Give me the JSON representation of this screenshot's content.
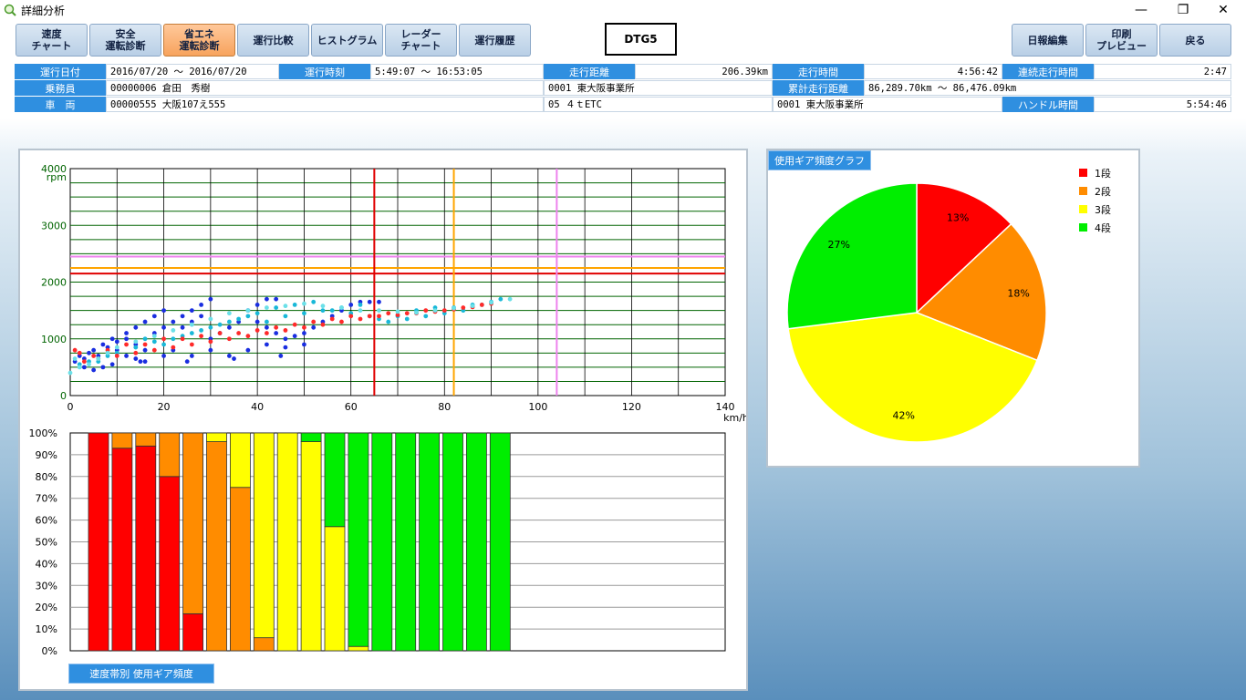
{
  "window": {
    "title": "詳細分析",
    "minimize_glyph": "—",
    "maximize_glyph": "❐",
    "close_glyph": "✕",
    "app_icon": "magnifier-chart-icon"
  },
  "toolbar": {
    "buttons": [
      {
        "label": "速度\nチャート"
      },
      {
        "label": "安全\n運転診断"
      },
      {
        "label": "省エネ\n運転診断",
        "active": true
      },
      {
        "label": "運行比較"
      },
      {
        "label": "ヒストグラム"
      },
      {
        "label": "レーダー\nチャート"
      },
      {
        "label": "運行履歴"
      }
    ],
    "model": "DTG5",
    "right_buttons": [
      {
        "label": "日報編集"
      },
      {
        "label": "印刷\nプレビュー"
      },
      {
        "label": "戻る"
      }
    ]
  },
  "info": {
    "r1": {
      "date_label": "運行日付",
      "date_value": "2016/07/20 〜 2016/07/20",
      "time_label": "運行時刻",
      "time_value": "5:49:07 〜 16:53:05",
      "distance_label": "走行距離",
      "distance_value": "206.39km",
      "drive_time_label": "走行時間",
      "drive_time_value": "4:56:42",
      "continuous_label": "連続走行時間",
      "continuous_value": "2:47"
    },
    "r2": {
      "driver_label": "乗務員",
      "driver_value": "00000006 倉田　秀樹",
      "office_value": "0001 東大阪事業所",
      "cumulative_label": "累計走行距離",
      "cumulative_value": "86,289.70km 〜 86,476.09km"
    },
    "r3": {
      "vehicle_label": "車　両",
      "vehicle_value": "00000555 大阪107え555",
      "vehicle_type_value": "05 ４ｔETC",
      "vehicle_office_value": "0001 東大阪事業所",
      "handle_label": "ハンドル時間",
      "handle_value": "5:54:46"
    }
  },
  "colors": {
    "gear1": "#ff0000",
    "gear2": "#ff8c00",
    "gear3": "#ffff00",
    "gear4": "#00ee00",
    "grid": "#006400",
    "red_line": "#e00000",
    "orange_line": "#ffa500",
    "pink_line": "#ee82ee",
    "label_blue": "#2f8fe0"
  },
  "chart_data": [
    {
      "type": "scatter",
      "title": "",
      "xlabel": "km/h",
      "ylabel": "rpm",
      "xlim": [
        0,
        140
      ],
      "ylim": [
        0,
        4000
      ],
      "x_ticks": [
        "0",
        "20",
        "40",
        "60",
        "80",
        "100",
        "120",
        "140"
      ],
      "y_ticks": [
        "0",
        "1000",
        "2000",
        "3000",
        "4000"
      ],
      "grid": true,
      "reference_lines": {
        "vertical": [
          {
            "x": 65,
            "color": "red"
          },
          {
            "x": 82,
            "color": "orange"
          },
          {
            "x": 104,
            "color": "pink"
          }
        ],
        "horizontal": [
          {
            "y": 2150,
            "color": "red"
          },
          {
            "y": 2250,
            "color": "orange"
          },
          {
            "y": 2450,
            "color": "pink"
          }
        ]
      },
      "series": [
        {
          "points": [
            [
              1,
              600
            ],
            [
              2,
              700
            ],
            [
              3,
              650
            ],
            [
              4,
              750
            ],
            [
              5,
              800
            ],
            [
              6,
              700
            ],
            [
              7,
              900
            ],
            [
              8,
              850
            ],
            [
              9,
              1000
            ],
            [
              10,
              950
            ],
            [
              12,
              1100
            ],
            [
              14,
              1200
            ],
            [
              16,
              1300
            ],
            [
              18,
              1400
            ],
            [
              20,
              1500
            ],
            [
              12,
              1000
            ],
            [
              14,
              900
            ],
            [
              16,
              800
            ],
            [
              18,
              1100
            ],
            [
              20,
              1200
            ],
            [
              22,
              1300
            ],
            [
              24,
              1400
            ],
            [
              26,
              1500
            ],
            [
              28,
              1600
            ],
            [
              30,
              1700
            ],
            [
              24,
              1200
            ],
            [
              26,
              1300
            ],
            [
              28,
              1400
            ],
            [
              30,
              1000
            ],
            [
              32,
              1100
            ],
            [
              34,
              1200
            ],
            [
              36,
              1300
            ],
            [
              38,
              1500
            ],
            [
              40,
              1600
            ],
            [
              42,
              1700
            ],
            [
              44,
              1700
            ],
            [
              40,
              1300
            ],
            [
              42,
              1200
            ],
            [
              44,
              1100
            ],
            [
              46,
              1000
            ],
            [
              48,
              1050
            ],
            [
              50,
              1100
            ],
            [
              52,
              1200
            ],
            [
              54,
              1300
            ],
            [
              56,
              1400
            ],
            [
              58,
              1500
            ],
            [
              60,
              1600
            ],
            [
              62,
              1650
            ],
            [
              64,
              1650
            ],
            [
              66,
              1650
            ],
            [
              10,
              800
            ],
            [
              12,
              700
            ],
            [
              14,
              650
            ],
            [
              16,
              600
            ],
            [
              20,
              700
            ],
            [
              22,
              800
            ],
            [
              26,
              700
            ],
            [
              30,
              800
            ],
            [
              34,
              700
            ],
            [
              38,
              800
            ],
            [
              42,
              900
            ],
            [
              46,
              850
            ],
            [
              50,
              900
            ],
            [
              3,
              500
            ],
            [
              5,
              450
            ],
            [
              7,
              500
            ],
            [
              9,
              550
            ],
            [
              15,
              600
            ],
            [
              25,
              600
            ],
            [
              35,
              650
            ],
            [
              45,
              700
            ]
          ]
        },
        {
          "points": [
            [
              2,
              550
            ],
            [
              4,
              600
            ],
            [
              6,
              600
            ],
            [
              8,
              700
            ],
            [
              10,
              750
            ],
            [
              14,
              850
            ],
            [
              18,
              950
            ],
            [
              22,
              1000
            ],
            [
              26,
              1100
            ],
            [
              30,
              1200
            ],
            [
              34,
              1300
            ],
            [
              38,
              1400
            ],
            [
              42,
              1300
            ],
            [
              46,
              1400
            ],
            [
              50,
              1450
            ],
            [
              54,
              1500
            ],
            [
              58,
              1550
            ],
            [
              62,
              1600
            ],
            [
              68,
              1300
            ],
            [
              72,
              1350
            ],
            [
              76,
              1400
            ],
            [
              80,
              1450
            ],
            [
              84,
              1500
            ],
            [
              88,
              1600
            ],
            [
              92,
              1700
            ],
            [
              16,
              1000
            ],
            [
              20,
              900
            ],
            [
              24,
              1050
            ],
            [
              28,
              1150
            ],
            [
              32,
              1250
            ],
            [
              36,
              1350
            ],
            [
              40,
              1450
            ],
            [
              44,
              1550
            ],
            [
              48,
              1600
            ],
            [
              52,
              1650
            ],
            [
              56,
              1500
            ],
            [
              60,
              1450
            ],
            [
              64,
              1400
            ],
            [
              66,
              1350
            ],
            [
              70,
              1400
            ],
            [
              74,
              1500
            ],
            [
              78,
              1550
            ],
            [
              82,
              1550
            ],
            [
              86,
              1600
            ],
            [
              90,
              1650
            ]
          ]
        },
        {
          "points": [
            [
              1,
              800
            ],
            [
              2,
              750
            ],
            [
              5,
              700
            ],
            [
              8,
              800
            ],
            [
              12,
              900
            ],
            [
              16,
              900
            ],
            [
              20,
              1000
            ],
            [
              24,
              1000
            ],
            [
              28,
              1050
            ],
            [
              32,
              1100
            ],
            [
              36,
              1100
            ],
            [
              40,
              1150
            ],
            [
              44,
              1200
            ],
            [
              48,
              1250
            ],
            [
              52,
              1300
            ],
            [
              56,
              1350
            ],
            [
              60,
              1400
            ],
            [
              64,
              1400
            ],
            [
              68,
              1450
            ],
            [
              72,
              1450
            ],
            [
              76,
              1500
            ],
            [
              80,
              1500
            ],
            [
              84,
              1550
            ],
            [
              88,
              1600
            ],
            [
              3,
              600
            ],
            [
              6,
              650
            ],
            [
              10,
              700
            ],
            [
              14,
              750
            ],
            [
              18,
              800
            ],
            [
              22,
              850
            ],
            [
              26,
              900
            ],
            [
              30,
              950
            ],
            [
              34,
              1000
            ],
            [
              38,
              1050
            ],
            [
              42,
              1100
            ],
            [
              46,
              1150
            ],
            [
              50,
              1200
            ],
            [
              54,
              1250
            ],
            [
              58,
              1300
            ],
            [
              62,
              1350
            ],
            [
              66,
              1400
            ],
            [
              70,
              1420
            ],
            [
              74,
              1450
            ],
            [
              78,
              1480
            ],
            [
              82,
              1520
            ],
            [
              86,
              1560
            ],
            [
              90,
              1620
            ]
          ]
        },
        {
          "points": [
            [
              0,
              400
            ],
            [
              1,
              650
            ],
            [
              2,
              500
            ],
            [
              4,
              550
            ],
            [
              6,
              650
            ],
            [
              8,
              750
            ],
            [
              10,
              850
            ],
            [
              14,
              950
            ],
            [
              18,
              1050
            ],
            [
              22,
              1150
            ],
            [
              26,
              1250
            ],
            [
              30,
              1350
            ],
            [
              34,
              1450
            ],
            [
              38,
              1500
            ],
            [
              42,
              1550
            ],
            [
              46,
              1580
            ],
            [
              50,
              1620
            ],
            [
              54,
              1580
            ],
            [
              58,
              1550
            ],
            [
              62,
              1500
            ],
            [
              66,
              1500
            ],
            [
              70,
              1480
            ],
            [
              74,
              1460
            ],
            [
              78,
              1500
            ],
            [
              82,
              1540
            ],
            [
              86,
              1580
            ],
            [
              90,
              1640
            ],
            [
              94,
              1700
            ]
          ]
        }
      ]
    },
    {
      "type": "bar",
      "title": "",
      "caption": "速度帯別 使用ギア頻度",
      "ylim": [
        0,
        100
      ],
      "y_ticks": [
        "0%",
        "10%",
        "20%",
        "30%",
        "40%",
        "50%",
        "60%",
        "70%",
        "80%",
        "90%",
        "100%"
      ],
      "stacked": true,
      "series": [
        {
          "name": "1段",
          "values": [
            100,
            93,
            94,
            80,
            17,
            0,
            0,
            0,
            0,
            0,
            0,
            0,
            0,
            0,
            0,
            0,
            0,
            0
          ]
        },
        {
          "name": "2段",
          "values": [
            0,
            7,
            6,
            20,
            83,
            96,
            75,
            6,
            0,
            0,
            0,
            0,
            0,
            0,
            0,
            0,
            0,
            0
          ]
        },
        {
          "name": "3段",
          "values": [
            0,
            0,
            0,
            0,
            0,
            4,
            25,
            94,
            100,
            96,
            57,
            2,
            0,
            0,
            0,
            0,
            0,
            0
          ]
        },
        {
          "name": "4段",
          "values": [
            0,
            0,
            0,
            0,
            0,
            0,
            0,
            0,
            0,
            4,
            43,
            98,
            100,
            100,
            100,
            100,
            100,
            100
          ]
        }
      ]
    },
    {
      "type": "pie",
      "title": "使用ギア頻度グラフ",
      "legend_position": "top-right",
      "slices": [
        {
          "name": "1段",
          "value": 13
        },
        {
          "name": "2段",
          "value": 18
        },
        {
          "name": "3段",
          "value": 42
        },
        {
          "name": "4段",
          "value": 27
        }
      ]
    }
  ]
}
